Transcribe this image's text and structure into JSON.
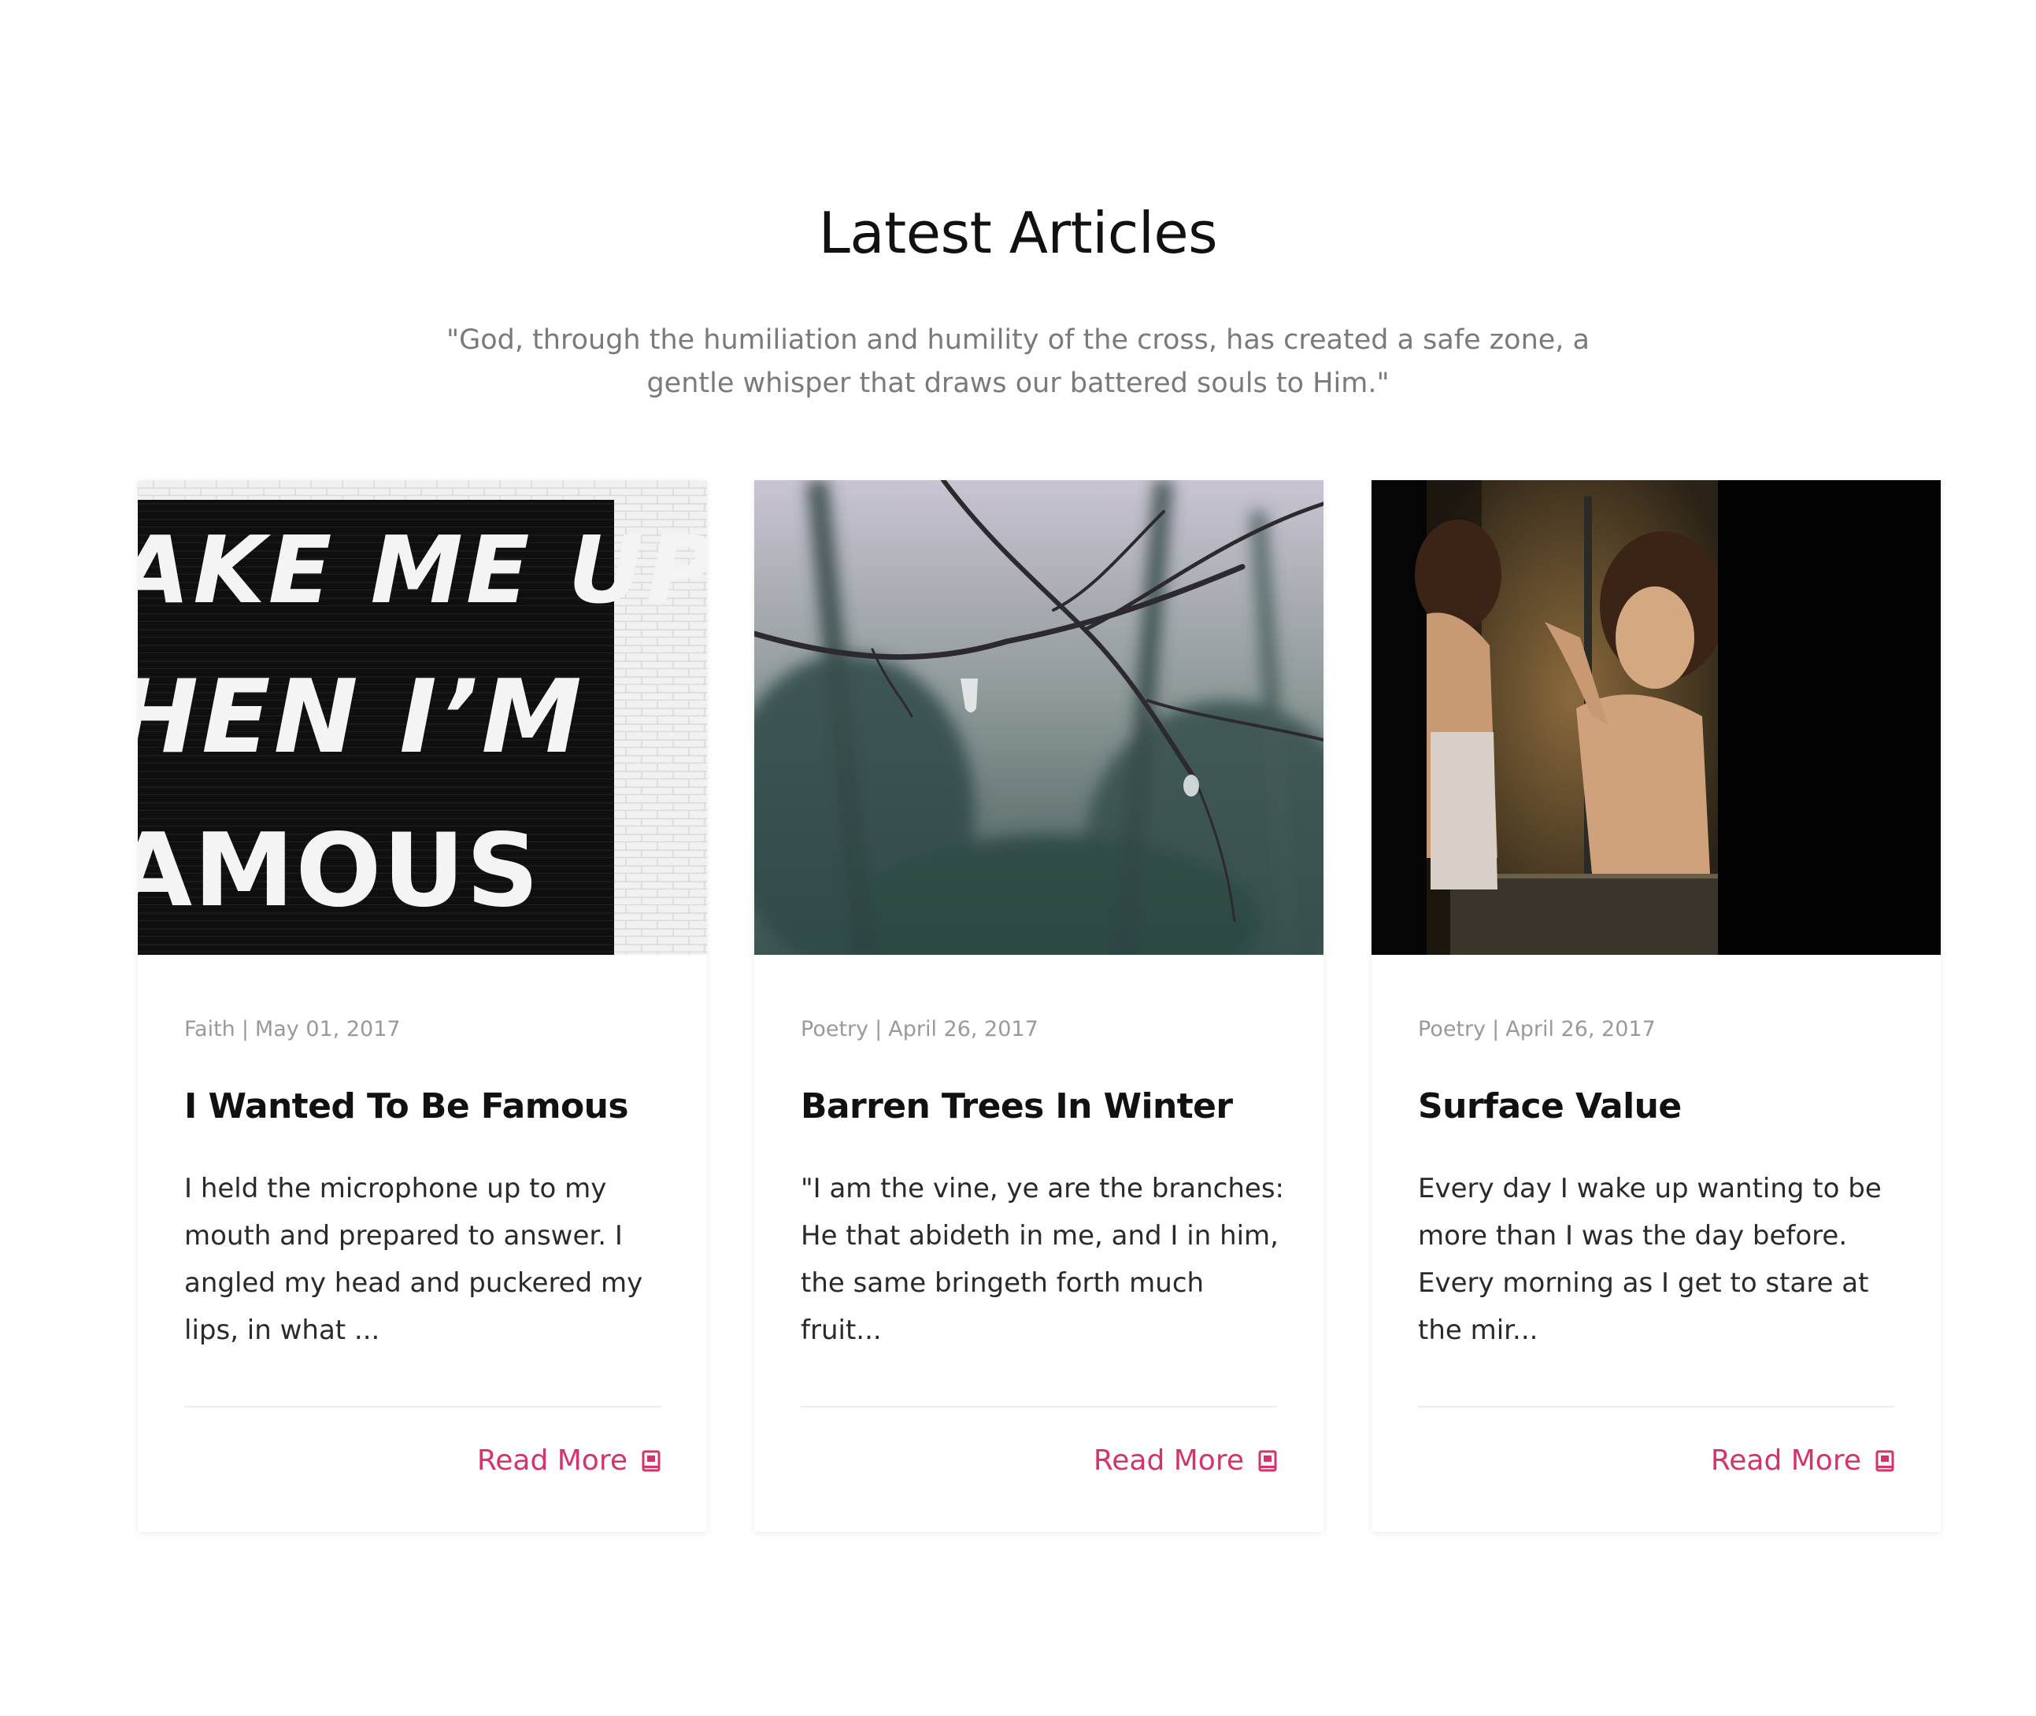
{
  "section": {
    "title": "Latest Articles",
    "quote": "\"God, through the humiliation and humility of the cross, has created a safe zone, a gentle whisper that draws our battered souls to Him.\""
  },
  "colors": {
    "accent": "#d6336c",
    "meta": "#9a9a9a",
    "quote": "#7a7a7a"
  },
  "articles": [
    {
      "image_text": [
        "AKE ME UP",
        "HEN I’M",
        "AMOUS"
      ],
      "category": "Faith",
      "separator": "|",
      "date": "May 01, 2017",
      "title": "I Wanted To Be Famous",
      "excerpt": "I held the microphone up to my mouth and prepared to answer. I angled my head and puckered my lips, in what ...",
      "read_more": "Read More",
      "icon": "book-icon"
    },
    {
      "category": "Poetry",
      "separator": "|",
      "date": "April 26, 2017",
      "title": "Barren Trees In Winter",
      "excerpt": "\"I am the vine, ye are the branches: He that abideth in me, and I in him, the same bringeth forth much fruit...",
      "read_more": "Read More",
      "icon": "book-icon"
    },
    {
      "category": "Poetry",
      "separator": "|",
      "date": "April 26, 2017",
      "title": "Surface Value",
      "excerpt": "Every day I wake up wanting to be more than I was the day before. Every morning as I get to stare at the mir...",
      "read_more": "Read More",
      "icon": "book-icon"
    }
  ]
}
